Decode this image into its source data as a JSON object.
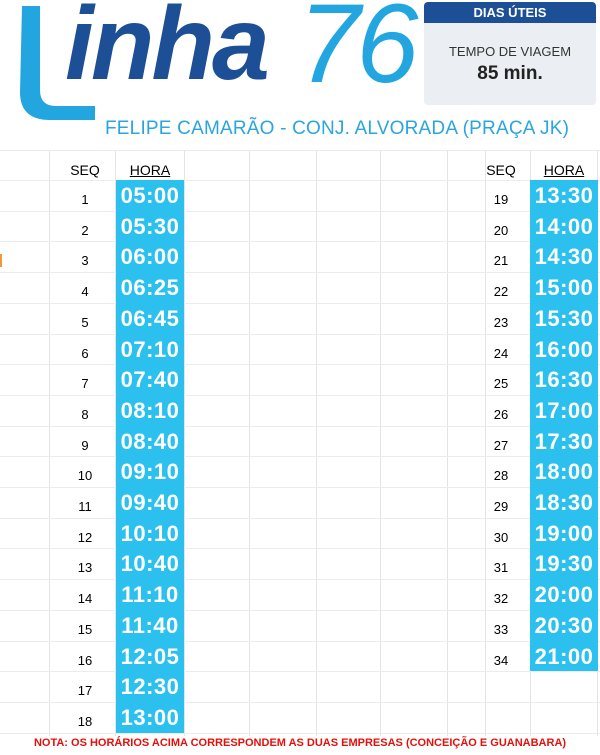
{
  "logo": {
    "word": "inha",
    "number": "76"
  },
  "info": {
    "days": "DIAS ÚTEIS",
    "travel_label": "TEMPO DE VIAGEM",
    "travel_value": "85 min."
  },
  "route": "FELIPE CAMARÃO - CONJ. ALVORADA (PRAÇA JK)",
  "headers": {
    "seq": "SEQ",
    "hora": "HORA"
  },
  "colors": {
    "brand_dark": "#1d4f97",
    "brand_light": "#23a6df",
    "time_bar": "#2cc0ef",
    "note_red": "#e3100c"
  },
  "left_schedule": [
    {
      "seq": "1",
      "time": "05:00"
    },
    {
      "seq": "2",
      "time": "05:30"
    },
    {
      "seq": "3",
      "time": "06:00"
    },
    {
      "seq": "4",
      "time": "06:25"
    },
    {
      "seq": "5",
      "time": "06:45"
    },
    {
      "seq": "6",
      "time": "07:10"
    },
    {
      "seq": "7",
      "time": "07:40"
    },
    {
      "seq": "8",
      "time": "08:10"
    },
    {
      "seq": "9",
      "time": "08:40"
    },
    {
      "seq": "10",
      "time": "09:10"
    },
    {
      "seq": "11",
      "time": "09:40"
    },
    {
      "seq": "12",
      "time": "10:10"
    },
    {
      "seq": "13",
      "time": "10:40"
    },
    {
      "seq": "14",
      "time": "11:10"
    },
    {
      "seq": "15",
      "time": "11:40"
    },
    {
      "seq": "16",
      "time": "12:05"
    },
    {
      "seq": "17",
      "time": "12:30"
    },
    {
      "seq": "18",
      "time": "13:00"
    }
  ],
  "right_schedule": [
    {
      "seq": "19",
      "time": "13:30"
    },
    {
      "seq": "20",
      "time": "14:00"
    },
    {
      "seq": "21",
      "time": "14:30"
    },
    {
      "seq": "22",
      "time": "15:00"
    },
    {
      "seq": "23",
      "time": "15:30"
    },
    {
      "seq": "24",
      "time": "16:00"
    },
    {
      "seq": "25",
      "time": "16:30"
    },
    {
      "seq": "26",
      "time": "17:00"
    },
    {
      "seq": "27",
      "time": "17:30"
    },
    {
      "seq": "28",
      "time": "18:00"
    },
    {
      "seq": "29",
      "time": "18:30"
    },
    {
      "seq": "30",
      "time": "19:00"
    },
    {
      "seq": "31",
      "time": "19:30"
    },
    {
      "seq": "32",
      "time": "20:00"
    },
    {
      "seq": "33",
      "time": "20:30"
    },
    {
      "seq": "34",
      "time": "21:00"
    }
  ],
  "note": "NOTA: OS HORÁRIOS ACIMA CORRESPONDEM AS DUAS EMPRESAS (CONCEIÇÃO E GUANABARA)"
}
